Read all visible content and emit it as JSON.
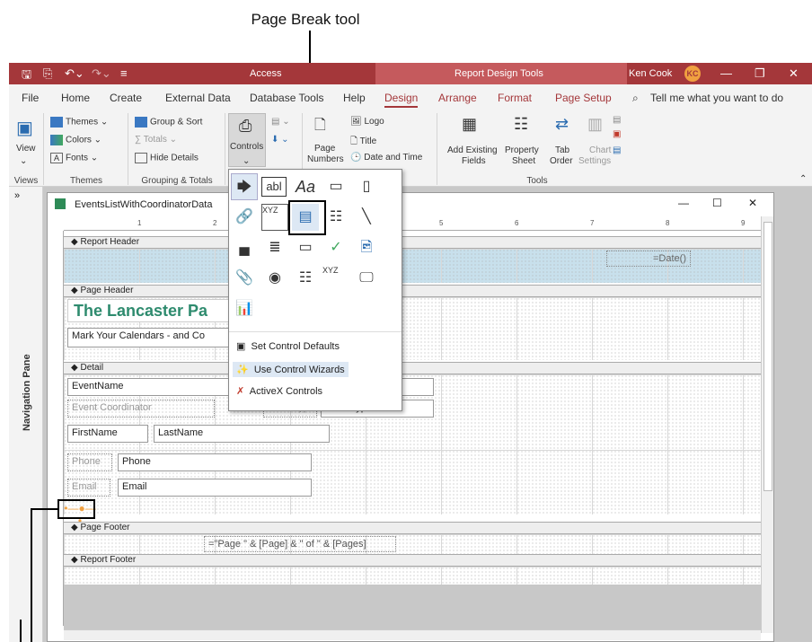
{
  "callout": {
    "page_break": "Page Break tool"
  },
  "titlebar": {
    "app": "Access",
    "context": "Report Design Tools",
    "user": "Ken Cook",
    "initials": "KC"
  },
  "menu": [
    "File",
    "Home",
    "Create",
    "External Data",
    "Database Tools",
    "Help",
    "Design",
    "Arrange",
    "Format",
    "Page Setup"
  ],
  "search": "Tell me what you want to do",
  "ribbon": {
    "view": "View",
    "themes": "Themes",
    "colors": "Colors",
    "fonts": "Fonts",
    "group_sort": "Group & Sort",
    "totals": "Totals",
    "hide_details": "Hide Details",
    "controls": "Controls",
    "page_numbers_1": "Page",
    "page_numbers_2": "Numbers",
    "logo": "Logo",
    "title": "Title",
    "date_time": "Date and Time",
    "add_fields_1": "Add Existing",
    "add_fields_2": "Fields",
    "property_1": "Property",
    "property_2": "Sheet",
    "tab_1": "Tab",
    "tab_2": "Order",
    "chart_1": "Chart",
    "chart_2": "Settings",
    "groups": {
      "views": "Views",
      "themes": "Themes",
      "grouping": "Grouping & Totals",
      "tools": "Tools"
    }
  },
  "nav_pane": "Navigation Pane",
  "window": {
    "title": "EventsListWithCoordinatorData"
  },
  "ruler": [
    "1",
    "2",
    "5",
    "6",
    "7",
    "8",
    "9"
  ],
  "sections": {
    "report_header": "Report Header",
    "page_header": "Page Header",
    "detail": "Detail",
    "page_footer": "Page Footer",
    "report_footer": "Report Footer"
  },
  "controls": {
    "date": "=Date()",
    "title": "The Lancaster Pa",
    "subtitle": "Mark Your Calendars - and Co",
    "event_name": "EventName",
    "event_coord": "Event Coordinator",
    "event_type_lbl": "EventType",
    "event_type": "EventType",
    "first": "FirstName",
    "last": "LastName",
    "phone_lbl": "Phone",
    "phone": "Phone",
    "email_lbl": "Email",
    "email": "Email",
    "page_expr": "=\"Page \" & [Page] & \" of \" & [Pages]"
  },
  "dropdown": {
    "set_defaults": "Set Control Defaults",
    "wizards": "Use Control Wizards",
    "activex": "ActiveX Controls",
    "textbox": "abl",
    "label": "Aa",
    "xyz": "XYZ"
  },
  "colors": {
    "accent": "#a4373a",
    "title_green": "#2e8b6e"
  }
}
